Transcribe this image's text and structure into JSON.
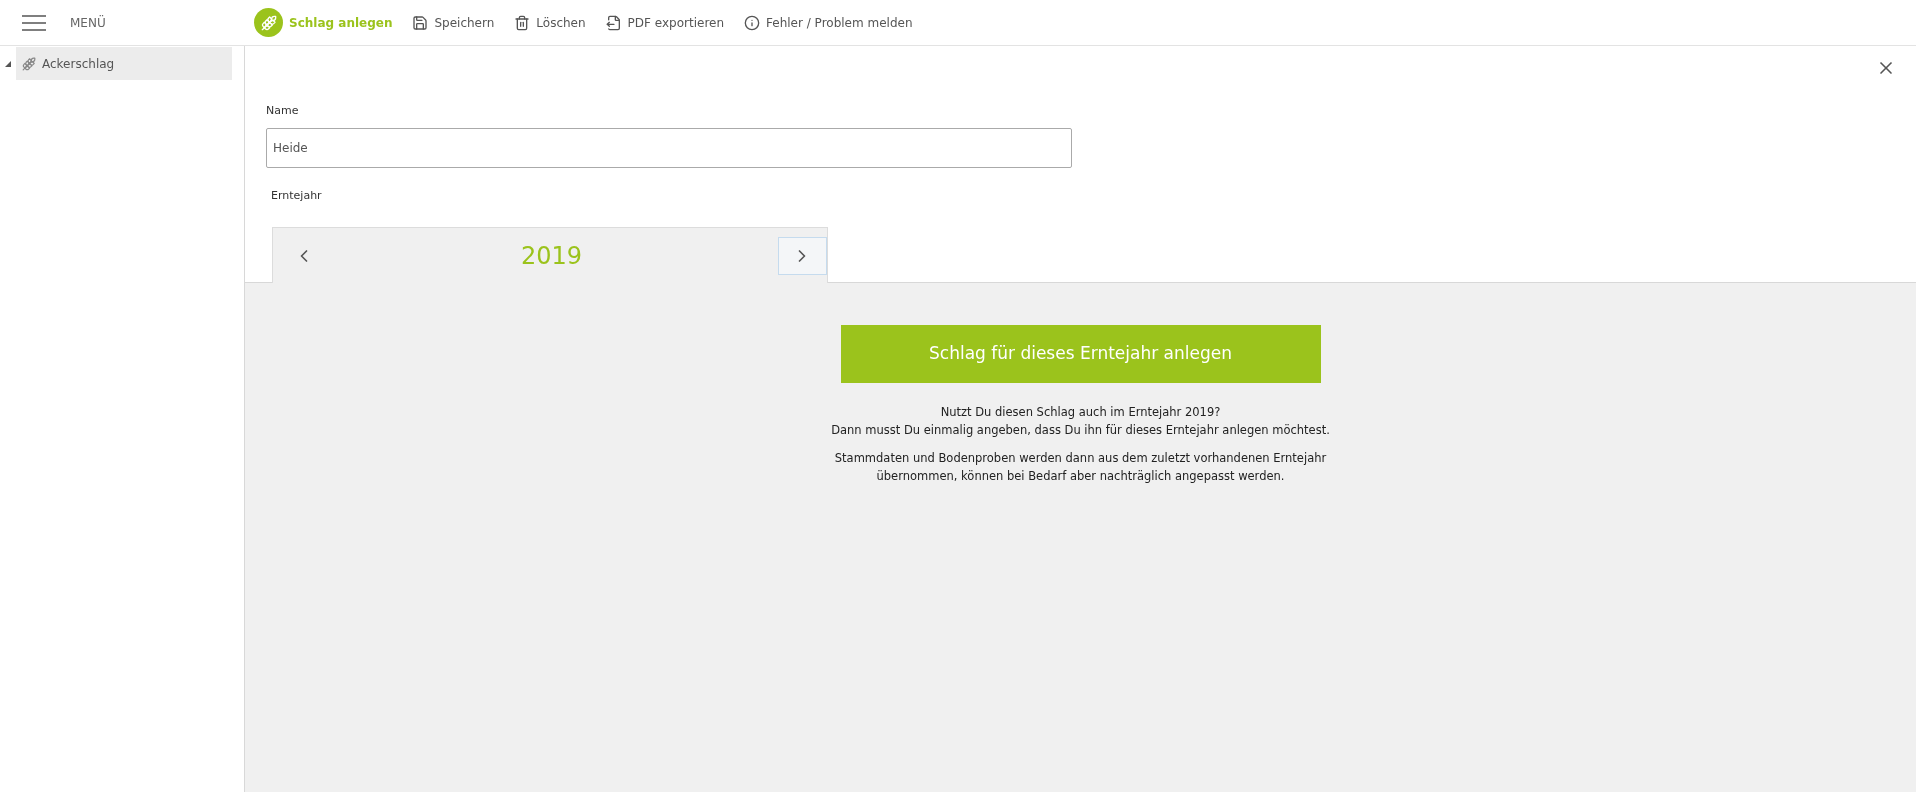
{
  "menu": {
    "label": "MENÜ"
  },
  "toolbar": [
    {
      "label": "Schlag anlegen",
      "kind": "primary"
    },
    {
      "label": "Speichern",
      "kind": "normal"
    },
    {
      "label": "Löschen",
      "kind": "normal"
    },
    {
      "label": "PDF exportieren",
      "kind": "normal"
    },
    {
      "label": "Fehler / Problem melden",
      "kind": "normal"
    }
  ],
  "sidebar": {
    "items": [
      {
        "label": "Ackerschlag",
        "expanded": true,
        "selected": true
      }
    ]
  },
  "form": {
    "name_label": "Name",
    "name_value": "Heide",
    "year_label": "Erntejahr",
    "year": "2019",
    "next_focused": true
  },
  "panel": {
    "button": "Schlag für dieses Erntejahr anlegen",
    "paragraphs": [
      "Nutzt Du diesen Schlag auch im Erntejahr 2019?\nDann musst Du einmalig angeben, dass Du ihn für dieses Erntejahr anlegen möchtest.",
      "Stammdaten und Bodenproben werden dann aus dem zuletzt vorhandenen Erntejahr\nübernommen, können bei Bedarf aber nachträglich angepasst werden."
    ]
  }
}
